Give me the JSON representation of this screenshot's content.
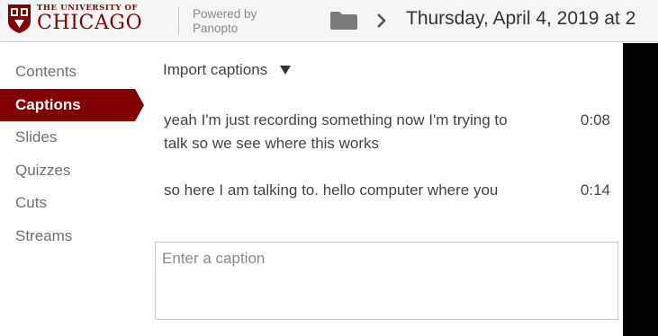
{
  "header": {
    "logo_small": "THE UNIVERSITY OF",
    "logo_big": "CHICAGO",
    "powered_line1": "Powered by",
    "powered_line2": "Panopto",
    "session_title": "Thursday, April 4, 2019 at 2",
    "icons": [
      "university-shield-icon",
      "folder-icon",
      "chevron-right-icon"
    ]
  },
  "sidebar": {
    "items": [
      {
        "label": "Contents",
        "active": false
      },
      {
        "label": "Captions",
        "active": true
      },
      {
        "label": "Slides",
        "active": false
      },
      {
        "label": "Quizzes",
        "active": false
      },
      {
        "label": "Cuts",
        "active": false
      },
      {
        "label": "Streams",
        "active": false
      }
    ]
  },
  "main": {
    "import_label": "Import captions",
    "captions": [
      {
        "text": "yeah I'm just recording something now I'm trying to talk so we see where this works",
        "time": "0:08"
      },
      {
        "text": "so here I am talking to. hello computer where you",
        "time": "0:14"
      }
    ],
    "input_placeholder": "Enter a caption"
  },
  "colors": {
    "brand": "#800000",
    "header_bg": "#f5f5f5",
    "nav_text": "#707070",
    "video_pane": "#000000"
  }
}
